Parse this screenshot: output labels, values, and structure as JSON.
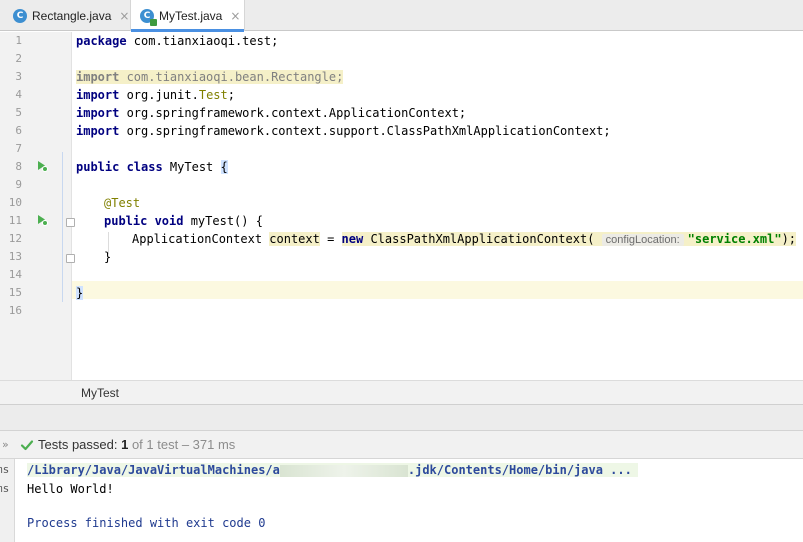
{
  "tabs": [
    {
      "label": "Rectangle.java",
      "icon": "java-class-icon",
      "close": "×"
    },
    {
      "label": "MyTest.java",
      "icon": "java-test-class-icon",
      "close": "×",
      "active": true
    }
  ],
  "editor": {
    "line_numbers": [
      "1",
      "2",
      "3",
      "4",
      "5",
      "6",
      "7",
      "8",
      "9",
      "10",
      "11",
      "12",
      "13",
      "14",
      "15",
      "16"
    ],
    "code": {
      "l1_kw": "package",
      "l1_rest": " com.tianxiaoqi.test;",
      "l3_kw": "import",
      "l3_rest": " com.tianxiaoqi.bean.Rectangle;",
      "l4_kw": "import",
      "l4_rest": " org.junit.",
      "l4_cls": "Test",
      "l4_end": ";",
      "l5_kw": "import",
      "l5_rest": " org.springframework.context.ApplicationContext;",
      "l6_kw": "import",
      "l6_rest": " org.springframework.context.support.ClassPathXmlApplicationContext;",
      "l8_kw": "public class",
      "l8_rest": " MyTest ",
      "l8_brace": "{",
      "l10_ann": "@Test",
      "l11_kw": "public void",
      "l11_rest": " myTest() {",
      "l12_type": "ApplicationContext ",
      "l12_var": "context",
      "l12_eq": " = ",
      "l12_new": "new",
      "l12_ctor": " ClassPathXmlApplicationContext(",
      "l12_hint": "configLocation:",
      "l12_str": "\"service.xml\"",
      "l12_end": ");",
      "l13": "}",
      "l15_brace": "}"
    }
  },
  "breadcrumb": "MyTest",
  "run": {
    "expand": "»",
    "status_prefix": "Tests passed: ",
    "status_count": "1",
    "status_of": " of 1 test",
    "status_time": " – 371 ms",
    "console": {
      "cmd_prefix": "/Library/Java/JavaVirtualMachines/a",
      "cmd_suffix": ".jdk/Contents/Home/bin/java ...",
      "output": "Hello World!",
      "exit": "Process finished with exit code 0"
    },
    "left_strip": [
      "ms",
      "ms"
    ]
  },
  "colors": {
    "pass_green": "#4caf50",
    "keyword": "#000080",
    "string": "#008000",
    "accent": "#4a90e2"
  }
}
